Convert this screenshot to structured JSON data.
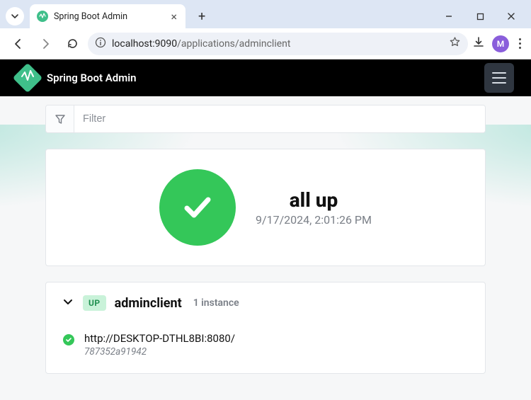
{
  "browser": {
    "tab_title": "Spring Boot Admin",
    "url_host": "localhost:9090",
    "url_path": "/applications/adminclient",
    "avatar_letter": "M"
  },
  "navbar": {
    "brand": "Spring Boot Admin"
  },
  "filter": {
    "placeholder": "Filter"
  },
  "status": {
    "title": "all up",
    "timestamp": "9/17/2024, 2:01:26 PM"
  },
  "application": {
    "badge": "UP",
    "name": "adminclient",
    "instance_count_label": "1 instance",
    "instance": {
      "url": "http://DESKTOP-DTHL8BI:8080/",
      "id": "787352a91942"
    }
  }
}
